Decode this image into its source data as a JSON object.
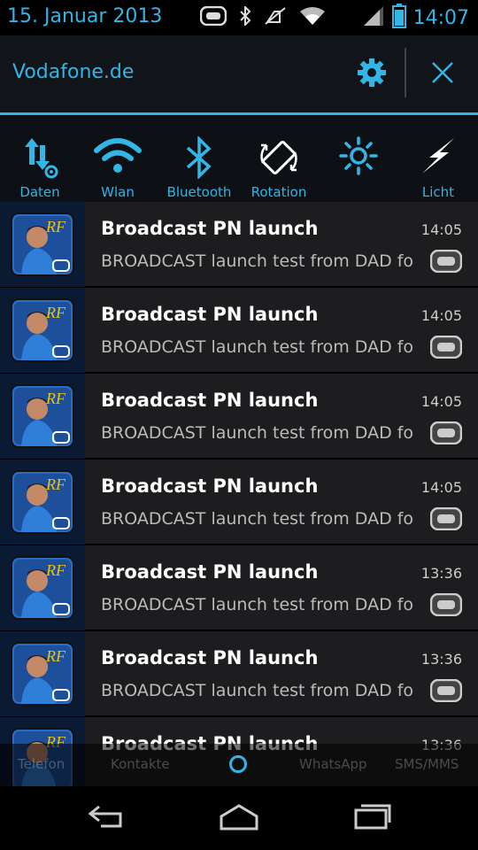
{
  "status_bar": {
    "date": "15. Januar 2013",
    "time": "14:07",
    "icons": [
      "gameloft-icon",
      "bluetooth-icon",
      "vibrate-off-icon",
      "wifi-icon",
      "signal-icon",
      "battery-icon"
    ]
  },
  "header": {
    "carrier": "Vodafone.de",
    "settings_icon": "gear-icon",
    "close_icon": "close-icon"
  },
  "toggles": [
    {
      "label": "Daten",
      "icon": "data-settings-icon"
    },
    {
      "label": "Wlan",
      "icon": "wifi-icon"
    },
    {
      "label": "Bluetooth",
      "icon": "bluetooth-icon"
    },
    {
      "label": "Rotation",
      "icon": "rotation-icon"
    },
    {
      "label": "",
      "icon": "brightness-icon"
    },
    {
      "label": "Licht",
      "icon": "flash-icon"
    }
  ],
  "notifications": [
    {
      "title": "Broadcast PN launch",
      "text": "BROADCAST launch test from DAD for",
      "time": "14:05"
    },
    {
      "title": "Broadcast PN launch",
      "text": "BROADCAST launch test from DAD for",
      "time": "14:05"
    },
    {
      "title": "Broadcast PN launch",
      "text": "BROADCAST launch test from DAD for",
      "time": "14:05"
    },
    {
      "title": "Broadcast PN launch",
      "text": "BROADCAST launch test from DAD for",
      "time": "14:05"
    },
    {
      "title": "Broadcast PN launch",
      "text": "BROADCAST launch test from DAD for",
      "time": "13:36"
    },
    {
      "title": "Broadcast PN launch",
      "text": "BROADCAST launch test from DAD for",
      "time": "13:36"
    },
    {
      "title": "Broadcast PN launch",
      "text": "",
      "time": "13:36"
    }
  ],
  "dock": {
    "items": [
      "Telefon",
      "Kontakte",
      "WhatsApp",
      "SMS/MMS"
    ]
  },
  "colors": {
    "accent": "#33b5e5",
    "notification_bg": "#1d1d1f",
    "header_bg": "#111418"
  }
}
